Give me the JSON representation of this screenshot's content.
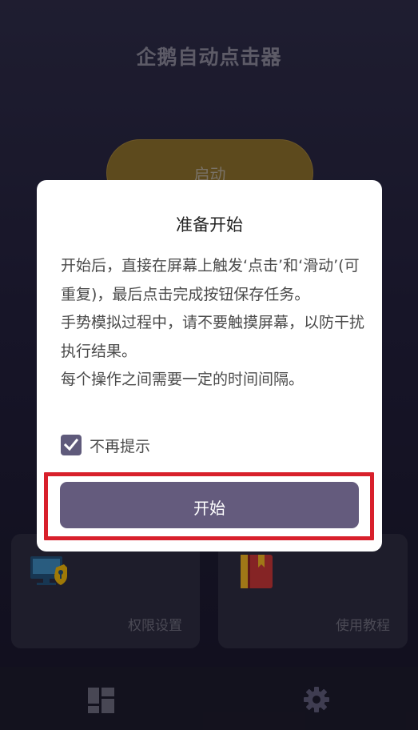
{
  "app": {
    "title": "企鹅自动点击器",
    "start_label": "启动",
    "cards": [
      {
        "label": "权限设置",
        "icon": "permission-settings-icon"
      },
      {
        "label": "使用教程",
        "icon": "tutorial-book-icon"
      }
    ],
    "nav": [
      {
        "icon": "dashboard-icon"
      },
      {
        "icon": "gear-icon"
      }
    ]
  },
  "dialog": {
    "title": "准备开始",
    "body": "开始后，直接在屏幕上触发‘点击’和‘滑动’(可重复)，最后点击完成按钮保存任务。\n手势模拟过程中，请不要触摸屏幕，以防干扰执行结果。\n每个操作之间需要一定的时间间隔。",
    "checkbox_label": "不再提示",
    "checkbox_checked": true,
    "confirm_label": "开始"
  },
  "colors": {
    "accent": "#645b7d",
    "highlight": "#d8202b",
    "start_button": "#8a6d22"
  }
}
